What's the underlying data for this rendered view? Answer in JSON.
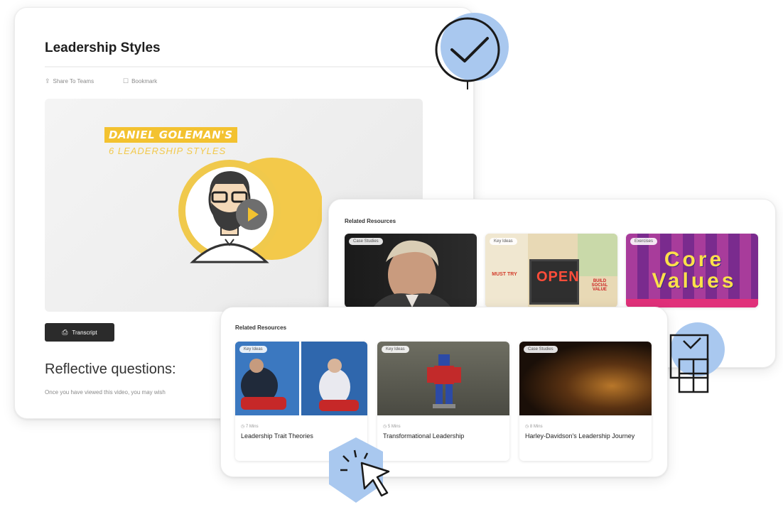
{
  "main": {
    "title": "Leadership Styles",
    "share_label": "Share To Teams",
    "bookmark_label": "Bookmark",
    "video": {
      "title_line1": "DANIEL GOLEMAN'S",
      "title_line2": "6 LEADERSHIP STYLES"
    },
    "transcript_label": "Transcript",
    "reflective_heading": "Reflective questions:",
    "reflective_text": "Once you have viewed this video, you may wish"
  },
  "related_top": {
    "heading": "Related Resources",
    "tiles": [
      {
        "tag": "Case Studies"
      },
      {
        "tag": "Key Ideas",
        "sign_text": "OPEN",
        "left_sign": "MUST TRY",
        "right_sign": "BUILD SOCIAL VALUE"
      },
      {
        "tag": "Exercises",
        "word_text": "Core Values"
      }
    ]
  },
  "related_bottom": {
    "heading": "Related Resources",
    "tiles": [
      {
        "tag": "Key Ideas",
        "meta": "7 Mins",
        "title": "Leadership Trait Theories"
      },
      {
        "tag": "Key Ideas",
        "meta": "5 Mins",
        "title": "Transformational Leadership"
      },
      {
        "tag": "Case Studies",
        "meta": "8 Mins",
        "title": "Harley-Davidson's Leadership Journey"
      }
    ]
  },
  "colors": {
    "accent_blue": "#a9c8ef",
    "gold": "#f2c230",
    "dark": "#2b2b2b"
  },
  "icons": [
    "checkmark-badge-icon",
    "cursor-click-badge-icon",
    "layout-badge-icon",
    "play-icon",
    "share-icon",
    "bookmark-icon",
    "transcript-icon",
    "clock-icon"
  ]
}
